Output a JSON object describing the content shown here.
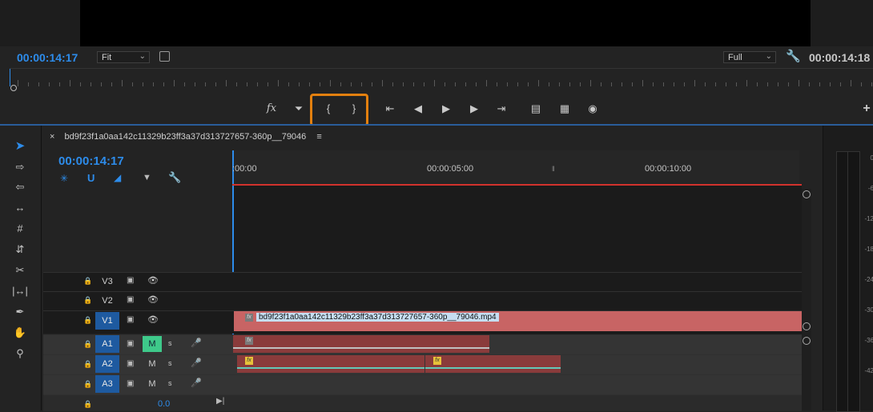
{
  "source_monitor": {
    "timecode_left": "00:00:14:17",
    "zoom_select": "Fit",
    "resolution_select": "Full",
    "timecode_right": "00:00:14:18"
  },
  "transport": {
    "buttons": [
      "fx-icon",
      "marker-icon",
      "mark-in-icon",
      "mark-out-icon",
      "go-to-in-icon",
      "step-back-icon",
      "play-icon",
      "step-forward-icon",
      "go-to-out-icon",
      "lift-icon",
      "extract-icon",
      "export-frame-icon",
      "add-icon"
    ]
  },
  "tools": [
    "selection-tool-icon",
    "track-select-tool-icon",
    "ripple-edit-tool-icon",
    "rolling-edit-tool-icon",
    "rate-stretch-tool-icon",
    "razor-tool-icon",
    "slip-tool-icon",
    "slide-tool-icon",
    "pen-tool-icon",
    "hand-tool-icon",
    "zoom-tool-icon"
  ],
  "sequence": {
    "tab_name": "bd9f23f1a0aa142c11329b23ff3a37d313727657-360p__79046",
    "timecode": "00:00:14:17",
    "ruler_labels": [
      ":00:00",
      "00:00:05:00",
      "00:00:10:00"
    ]
  },
  "tracks": {
    "video": [
      {
        "name": "V3",
        "targeted": false
      },
      {
        "name": "V2",
        "targeted": false
      },
      {
        "name": "V1",
        "targeted": true
      }
    ],
    "audio": [
      {
        "name": "A1",
        "mute_label": "M",
        "solo_label": "S",
        "muted": true
      },
      {
        "name": "A2",
        "mute_label": "M",
        "solo_label": "S",
        "muted": false
      },
      {
        "name": "A3",
        "mute_label": "M",
        "solo_label": "S",
        "muted": false
      }
    ],
    "master_volume": "0.0"
  },
  "clips": {
    "v1_label": "bd9f23f1a0aa142c11329b23ff3a37d313727657-360p__79046.mp4",
    "fx_label": "fx"
  },
  "meters": {
    "scale": [
      "0",
      "-6",
      "-12",
      "-18",
      "-24",
      "-30",
      "-36",
      "-42"
    ]
  },
  "colors": {
    "accent_blue": "#2d8ceb",
    "highlight_orange": "#e3800f",
    "video_clip": "#c86464",
    "audio_clip": "#8a3b3b",
    "mute_on": "#3ec98a"
  }
}
